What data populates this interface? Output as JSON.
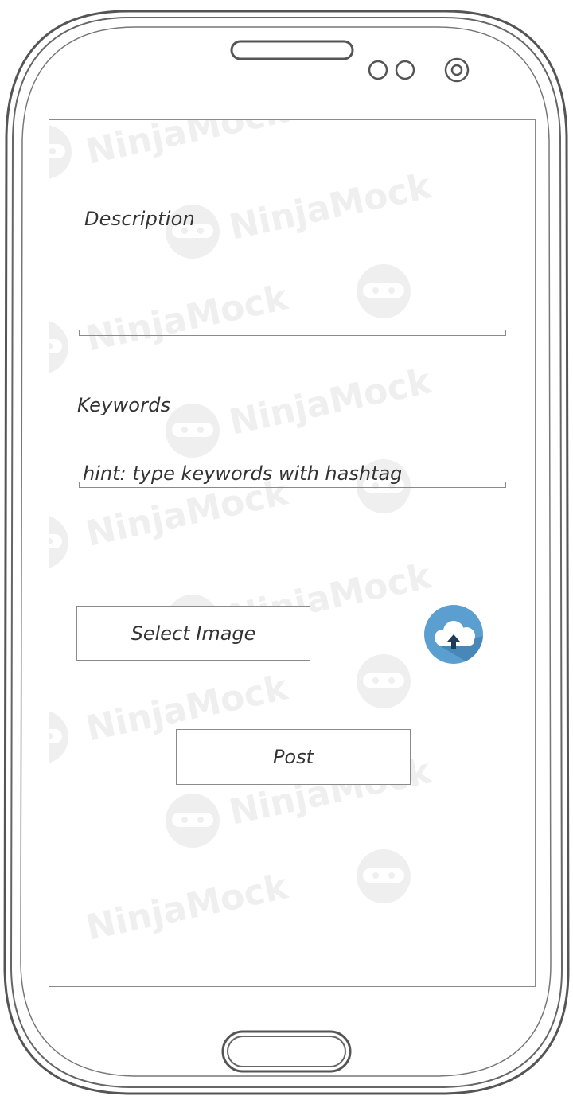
{
  "form": {
    "description_label": "Description",
    "description_value": "",
    "keywords_label": "Keywords",
    "keywords_value": "hint: type keywords with hashtag",
    "select_image_label": "Select Image",
    "post_label": "Post"
  },
  "watermark": {
    "text": "NinjaMock"
  },
  "icons": {
    "upload": "cloud-upload-icon"
  },
  "colors": {
    "frame_stroke": "#555555",
    "ui_stroke": "#8a8a8a",
    "text": "#333333",
    "upload_circle": "#5b9fd0",
    "watermark": "#eeeeee"
  }
}
